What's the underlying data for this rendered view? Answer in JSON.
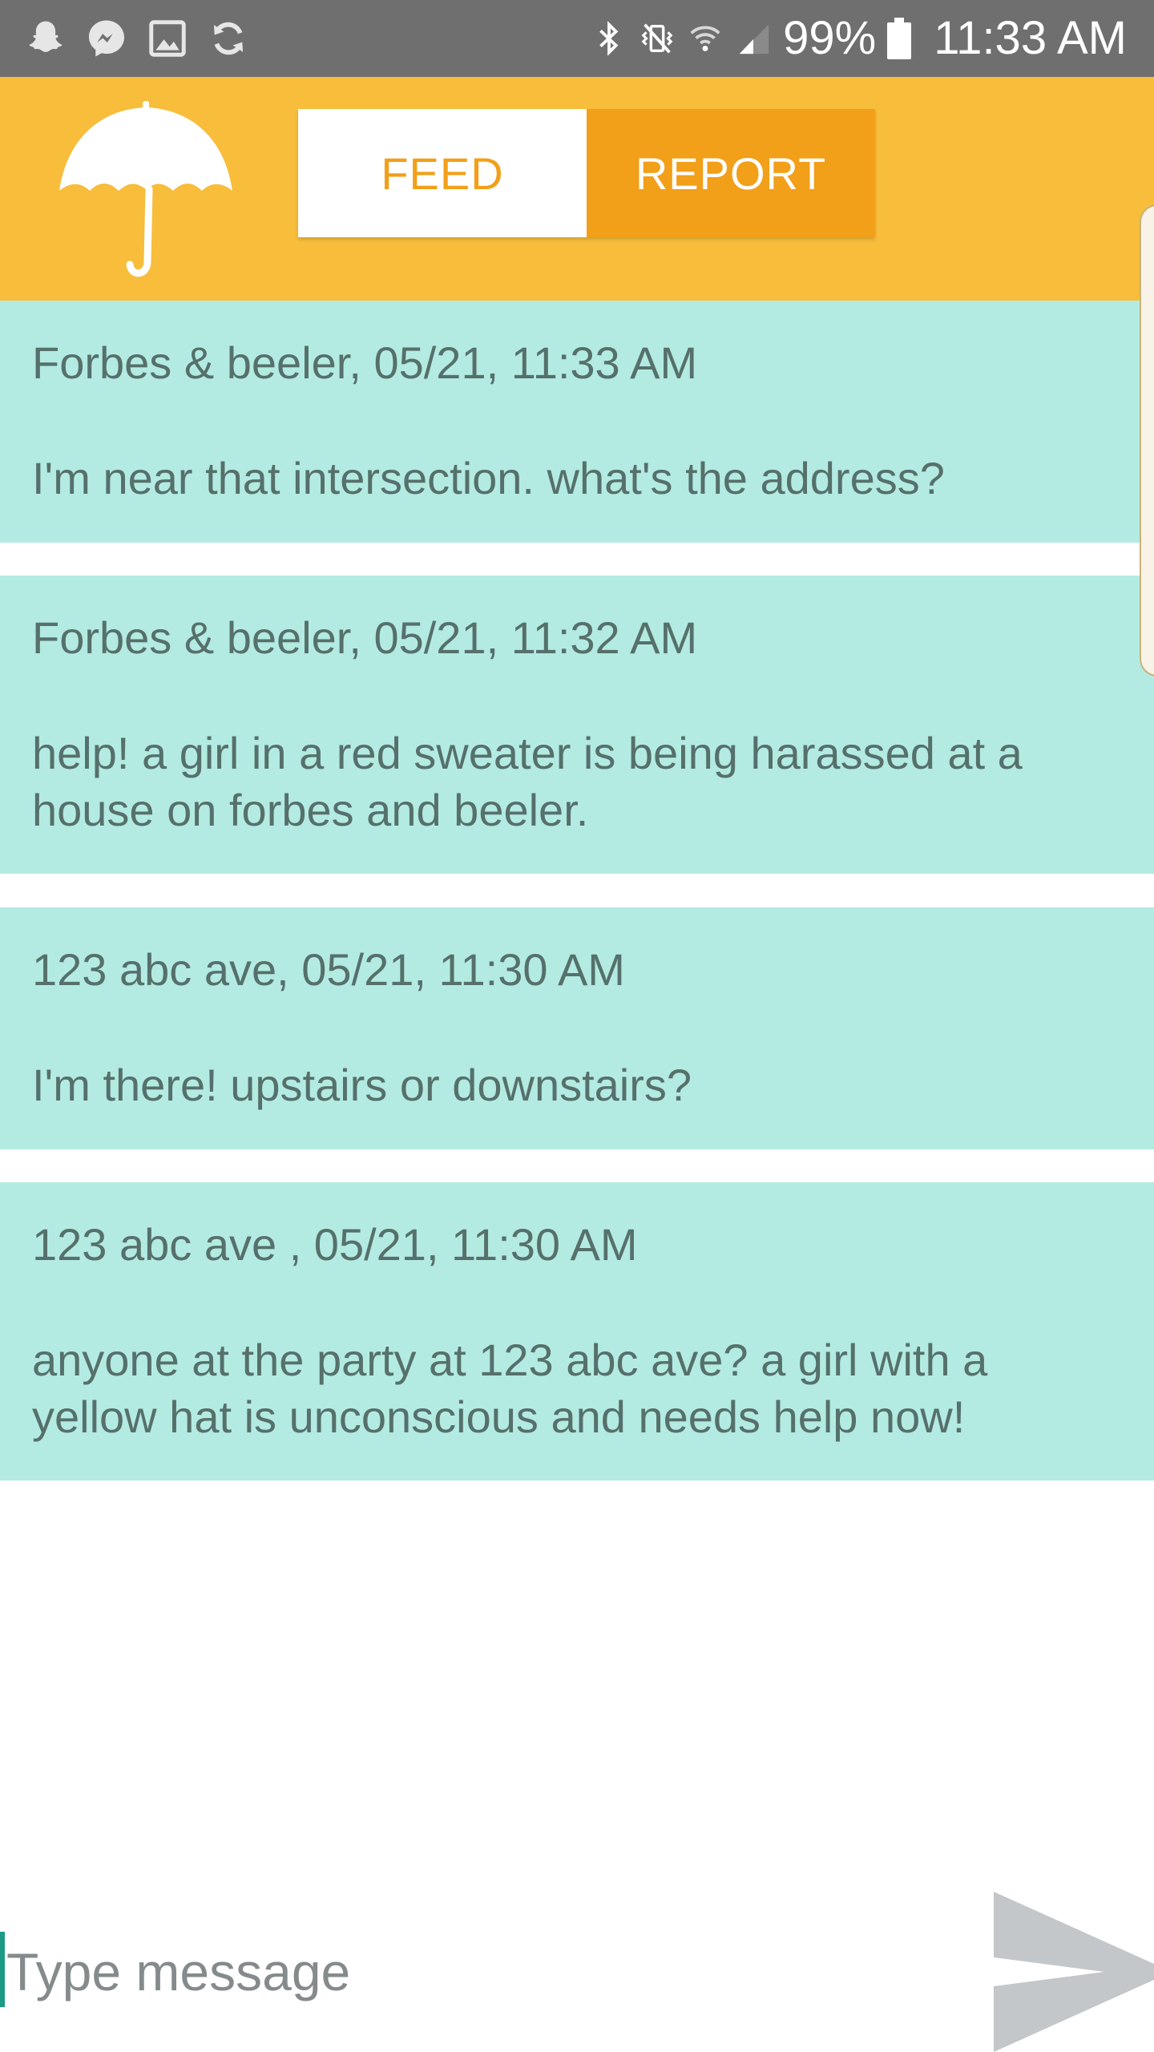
{
  "status_bar": {
    "battery": "99%",
    "time": "11:33 AM",
    "left_icons": [
      "snapchat-icon",
      "messenger-icon",
      "gallery-icon",
      "sync-icon"
    ],
    "right_icons": [
      "bluetooth-icon",
      "vibrate-icon",
      "wifi-icon",
      "signal-icon",
      "battery-icon"
    ]
  },
  "header": {
    "logo_icon": "umbrella-icon",
    "tabs": [
      {
        "label": "FEED",
        "active": true
      },
      {
        "label": "REPORT",
        "active": false
      }
    ]
  },
  "feed": {
    "items": [
      {
        "meta": "Forbes & beeler, 05/21, 11:33 AM",
        "text": "I'm near that intersection.  what's the address?"
      },
      {
        "meta": "Forbes & beeler, 05/21, 11:32 AM",
        "text": "help! a girl in a red sweater is being harassed at a house on forbes and beeler."
      },
      {
        "meta": "123 abc ave, 05/21, 11:30 AM",
        "text": "I'm there! upstairs or downstairs?"
      },
      {
        "meta": "123 abc ave , 05/21, 11:30 AM",
        "text": "anyone at the party at 123 abc ave? a girl with a yellow hat is unconscious and needs help now!"
      }
    ]
  },
  "composer": {
    "placeholder": "Type message",
    "value": "",
    "send_icon": "send-icon"
  },
  "colors": {
    "status_bar": "#6f6f6f",
    "header": "#f7bd3b",
    "accent": "#f29f19",
    "feed_item_bg": "#b3ebe2",
    "feed_text": "#56706b",
    "cursor": "#1c9a85",
    "send": "#c3c7ca"
  }
}
